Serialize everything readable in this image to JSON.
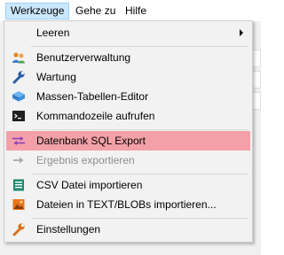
{
  "menubar": {
    "items": [
      {
        "label": "Werkzeuge"
      },
      {
        "label": "Gehe zu"
      },
      {
        "label": "Hilfe"
      }
    ]
  },
  "menu": {
    "items": {
      "leeren": {
        "label": "Leeren"
      },
      "benutzer": {
        "label": "Benutzerverwaltung",
        "icon": "users-icon"
      },
      "wartung": {
        "label": "Wartung",
        "icon": "wrench-icon"
      },
      "massen": {
        "label": "Massen-Tabellen-Editor",
        "icon": "stacked-tables-icon"
      },
      "kommando": {
        "label": "Kommandozeile aufrufen",
        "icon": "terminal-icon"
      },
      "sqlexport": {
        "label": "Datenbank SQL Export",
        "icon": "export-arrows-icon"
      },
      "ergebnis": {
        "label": "Ergebnis exportieren",
        "icon": "arrow-right-icon",
        "disabled": true
      },
      "csv": {
        "label": "CSV Datei importieren",
        "icon": "spreadsheet-icon"
      },
      "blob": {
        "label": "Dateien in TEXT/BLOBs importieren...",
        "icon": "image-file-icon"
      },
      "einstellungen": {
        "label": "Einstellungen",
        "icon": "wrench-icon"
      }
    }
  },
  "colors": {
    "highlight": "#f4a0a8",
    "menubar_active": "#cce8ff",
    "disabled_text": "#8d8d8d"
  }
}
